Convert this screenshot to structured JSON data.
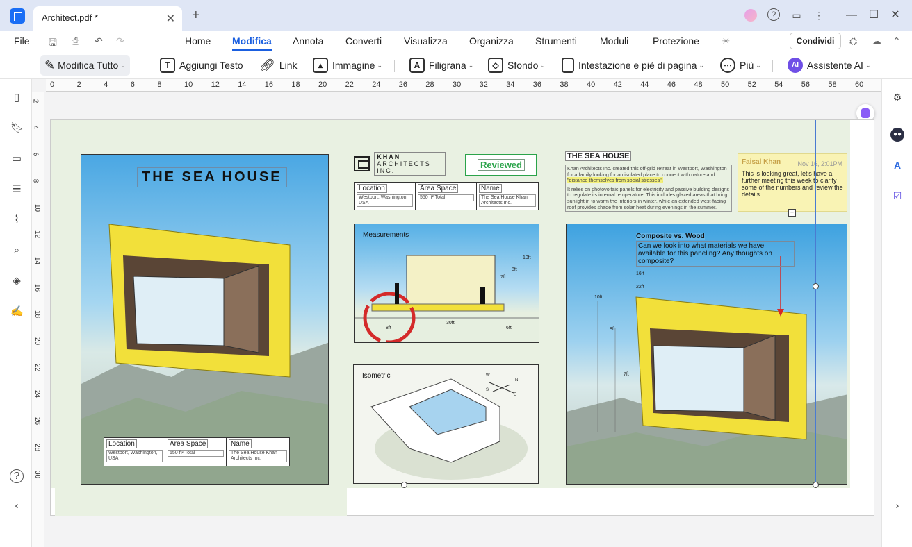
{
  "titlebar": {
    "tab_title": "Architect.pdf *",
    "close": "✕",
    "new_tab": "+"
  },
  "menubar": {
    "file": "File",
    "items": [
      "Home",
      "Modifica",
      "Annota",
      "Converti",
      "Visualizza",
      "Organizza",
      "Strumenti",
      "Moduli",
      "Protezione"
    ],
    "active": "Modifica",
    "share": "Condividi"
  },
  "toolbar": {
    "edit_all": "Modifica Tutto",
    "add_text": "Aggiungi Testo",
    "link": "Link",
    "image": "Immagine",
    "watermark": "Filigrana",
    "background": "Sfondo",
    "header_footer": "Intestazione e piè di pagina",
    "more": "Più",
    "ai_assistant": "Assistente AI",
    "ai_badge": "AI"
  },
  "ruler": {
    "h": [
      "0",
      "2",
      "4",
      "6",
      "8",
      "10",
      "12",
      "14",
      "16",
      "18",
      "20",
      "22",
      "24",
      "26",
      "28",
      "30",
      "32",
      "34",
      "36",
      "38",
      "40",
      "42",
      "44",
      "46",
      "48",
      "50",
      "52",
      "54",
      "56",
      "58",
      "60"
    ],
    "v": [
      "2",
      "4",
      "6",
      "8",
      "10",
      "12",
      "14",
      "16",
      "18",
      "20",
      "22",
      "24",
      "26",
      "28",
      "30"
    ]
  },
  "document": {
    "left_title": "THE SEA HOUSE",
    "info_table": [
      {
        "header": "Location",
        "value": "Westport, Washington, USA"
      },
      {
        "header": "Area Space",
        "value": "550 ft² Total"
      },
      {
        "header": "Name",
        "value": "The Sea House Khan Architects Inc."
      }
    ],
    "khan_name": "KHAN",
    "khan_sub": "ARCHITECTS INC.",
    "reviewed": "Reviewed",
    "measurements_label": "Measurements",
    "measure_dims": {
      "d10": "10ft",
      "d8": "8ft",
      "d7": "7ft",
      "w8": "8ft",
      "w30": "30ft",
      "w6": "6ft"
    },
    "isometric_label": "Isometric",
    "compass": {
      "w": "W",
      "n": "N",
      "s": "S",
      "e": "E"
    },
    "right_title": "THE SEA HOUSE",
    "right_text_1": "Khan Architects Inc. created this off-grid retreat in Westport, Washington for a family looking for an isolated place to connect with nature and",
    "right_text_hl": "\"distance themselves from social stresses\".",
    "right_text_2": "It relies on photovoltaic panels for electricity and passive building designs to regulate its internal temperature. This includes glazed areas that bring sunlight in to warm the interiors in winter, while an extended west-facing roof provides shade from solar heat during evenings in the summer.",
    "callout_title": "Composite vs. Wood",
    "callout_body": "Can we look into what materials we have available for this paneling? Any thoughts on composite?",
    "right_dims": {
      "d16": "16ft",
      "d22": "22ft",
      "d10": "10ft",
      "d8": "8ft",
      "d7": "7ft"
    }
  },
  "note": {
    "author": "Faisal Khan",
    "time": "Nov 16, 2:01PM",
    "body": "This is looking great, let's have a further meeting this week to clarify some of the numbers and review the details."
  },
  "colors": {
    "accent": "#1a5fe0",
    "reviewed": "#2ba34a",
    "house_yellow": "#f2e03a",
    "note_bg": "#f9f3b4"
  }
}
